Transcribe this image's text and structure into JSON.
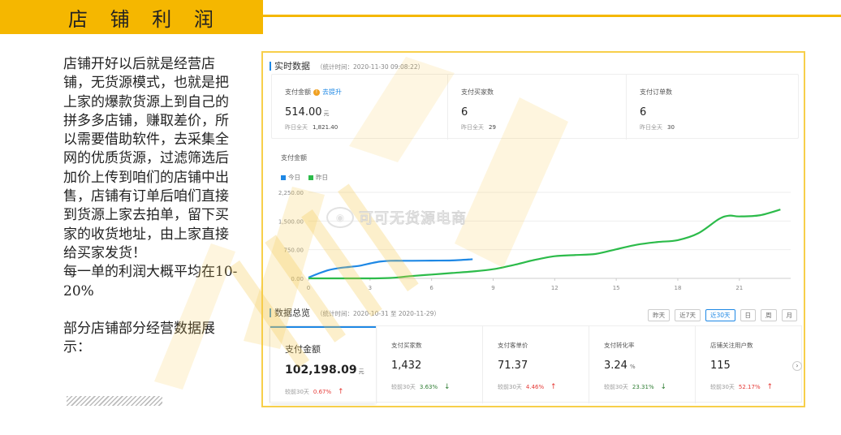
{
  "header": {
    "title": "店 铺 利 润"
  },
  "left_text": {
    "paragraph1": "店铺开好以后就是经营店铺，无货源模式，也就是把上家的爆款货源上到自己的拼多多店铺，赚取差价，所以需要借助软件，去采集全网的优质货源，过滤筛选后加价上传到咱们的店铺中出售，店铺有订单后咱们直接到货源上家去拍单，留下买家的收货地址，由上家直接给买家发货！",
    "paragraph2": "每一单的利润大概平均在10-20%",
    "paragraph3": "部分店铺部分经营数据展示："
  },
  "realtime": {
    "title": "实时数据",
    "stat_time": "（统计时间：2020-11-30 09:08:22）",
    "cards": [
      {
        "label": "支付金额",
        "link": "去提升",
        "value": "514.00",
        "unit": "元",
        "sub_label": "昨日全天",
        "sub_value": "1,821.40"
      },
      {
        "label": "支付买家数",
        "value": "6",
        "sub_label": "昨日全天",
        "sub_value": "29"
      },
      {
        "label": "支付订单数",
        "value": "6",
        "sub_label": "昨日全天",
        "sub_value": "30"
      }
    ]
  },
  "chart_data": {
    "type": "line",
    "title": "支付金额",
    "x_ticks": [
      0,
      3,
      6,
      9,
      12,
      15,
      18,
      21
    ],
    "y_ticks": [
      "0.00",
      "750.00",
      "1,500.00",
      "2,250.00"
    ],
    "xlim": [
      0,
      23.5
    ],
    "ylim": [
      0,
      2250
    ],
    "series": [
      {
        "name": "今日",
        "color": "#1e88e5",
        "x": [
          0,
          0.5,
          1,
          1.5,
          2,
          2.5,
          3,
          3.5,
          4,
          5,
          6,
          7,
          8
        ],
        "y": [
          20,
          130,
          220,
          270,
          300,
          330,
          390,
          440,
          460,
          460,
          465,
          470,
          500
        ]
      },
      {
        "name": "昨日",
        "color": "#2cbb4a",
        "x": [
          0,
          1,
          2,
          3,
          4,
          5,
          6,
          7,
          8,
          9,
          10,
          11,
          12,
          13,
          14,
          15,
          16,
          17,
          18,
          19,
          20,
          20.5,
          21,
          22,
          23
        ],
        "y": [
          0,
          0,
          0,
          0,
          10,
          60,
          100,
          140,
          180,
          240,
          350,
          480,
          580,
          610,
          640,
          760,
          880,
          950,
          1000,
          1180,
          1550,
          1640,
          1620,
          1650,
          1800
        ]
      }
    ]
  },
  "overview": {
    "title": "数据总览",
    "stat_time": "（统计时间：2020-10-31 至 2020-11-29）",
    "periods": [
      "昨天",
      "近7天",
      "近30天",
      "日",
      "周",
      "月"
    ],
    "active_period": "近30天",
    "cards": [
      {
        "label": "支付金额",
        "value": "102,198.09",
        "unit": "元",
        "sub_label": "较前30天",
        "change": "0.67%",
        "dir": "up"
      },
      {
        "label": "支付买家数",
        "value": "1,432",
        "sub_label": "较前30天",
        "change": "3.63%",
        "dir": "down"
      },
      {
        "label": "支付客单价",
        "value": "71.37",
        "sub_label": "较前30天",
        "change": "4.46%",
        "dir": "up"
      },
      {
        "label": "支付转化率",
        "value": "3.24",
        "unit": "%",
        "sub_label": "较前30天",
        "change": "23.31%",
        "dir": "down"
      },
      {
        "label": "店铺关注用户数",
        "value": "115",
        "sub_label": "较前30天",
        "change": "52.17%",
        "dir": "up"
      }
    ]
  },
  "watermark": {
    "text": "可可无货源电商"
  },
  "colors": {
    "accent": "#f5b700",
    "today": "#1e88e5",
    "yesterday": "#2cbb4a",
    "up": "#e53935",
    "down": "#2e7d32"
  }
}
